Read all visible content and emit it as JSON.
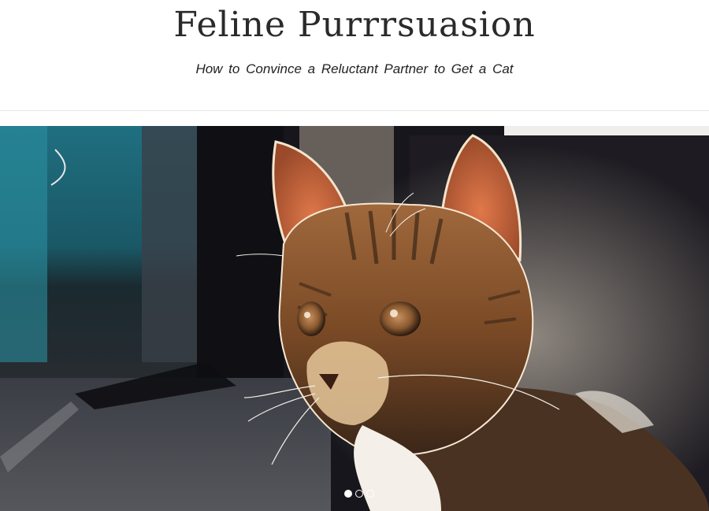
{
  "site": {
    "title": "Feline Purrrsuasion",
    "tagline": "How to Convince a Reluctant Partner to Get a Cat"
  },
  "slider": {
    "slide_count": 3,
    "active_slide": 1,
    "image_alt": "tabby kitten backlit by sunlight"
  },
  "colors": {
    "title": "#2a2a2a",
    "divider": "#e6e6e6",
    "dot": "#ffffff"
  }
}
